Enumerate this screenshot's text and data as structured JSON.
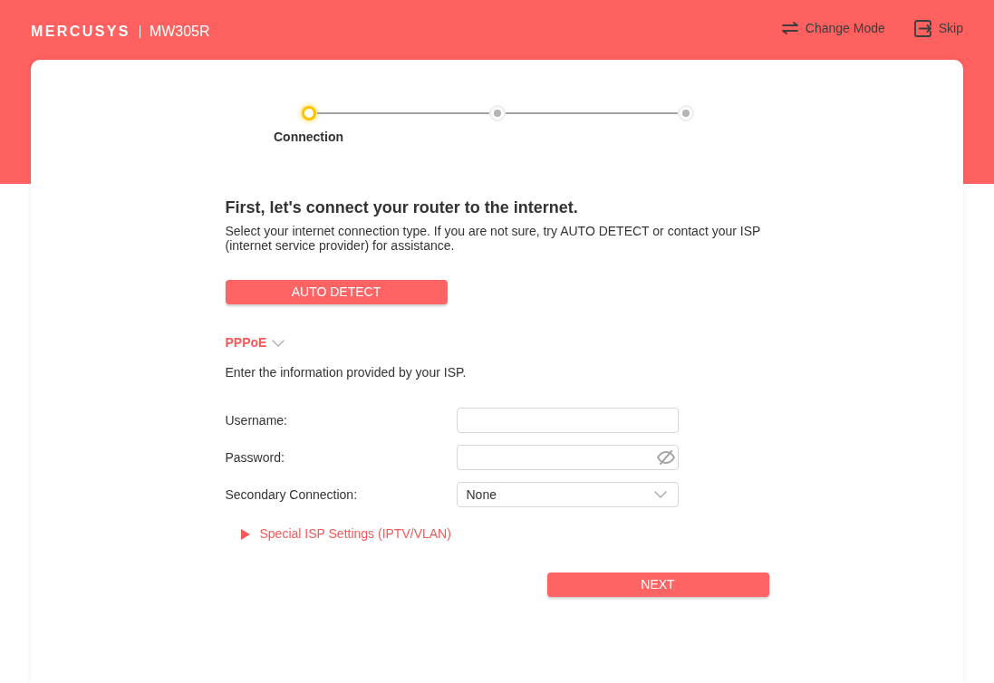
{
  "header": {
    "logo": "MERCUSYS",
    "model": "MW305R",
    "actions": [
      {
        "kind": "change-mode",
        "label": "Change Mode"
      },
      {
        "kind": "skip",
        "label": "Skip"
      }
    ]
  },
  "stepper": {
    "steps": [
      {
        "label": "Connection",
        "selected": true
      },
      {
        "selected": false
      },
      {
        "selected": false
      }
    ]
  },
  "intro": {
    "heading": "First, let's connect your router to the internet.",
    "description": "Select your internet connection type. If you are not sure, try AUTO DETECT or contact your ISP (internet service provider) for assistance."
  },
  "auto_detect_button": "AUTO DETECT",
  "connection_type": {
    "value": "PPPoE"
  },
  "instructions": "Enter the information provided by your ISP.",
  "form": {
    "fields": [
      {
        "kind": "text",
        "label": "Username:"
      },
      {
        "kind": "password",
        "label": "Password:",
        "shown": false
      },
      {
        "kind": "select",
        "label": "Secondary Connection:",
        "value": "None"
      }
    ]
  },
  "special_settings": {
    "label": "Special ISP Settings (IPTV/VLAN)",
    "expanded": false
  },
  "next_button": "NEXT"
}
